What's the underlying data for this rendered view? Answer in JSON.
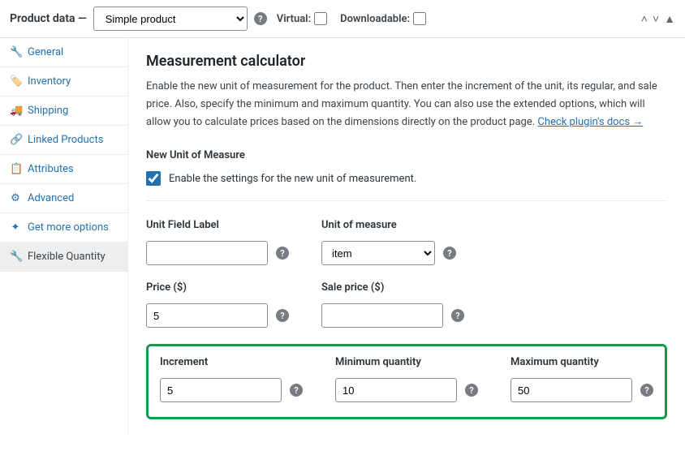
{
  "header": {
    "title": "Product data —",
    "product_type": "Simple product",
    "virtual_label": "Virtual:",
    "downloadable_label": "Downloadable:"
  },
  "sidebar": {
    "items": [
      {
        "label": "General",
        "icon": "🔧"
      },
      {
        "label": "Inventory",
        "icon": "🏷️"
      },
      {
        "label": "Shipping",
        "icon": "🚚"
      },
      {
        "label": "Linked Products",
        "icon": "🔗"
      },
      {
        "label": "Attributes",
        "icon": "📋"
      },
      {
        "label": "Advanced",
        "icon": "⚙"
      },
      {
        "label": "Get more options",
        "icon": "✦"
      },
      {
        "label": "Flexible Quantity",
        "icon": "🔧"
      }
    ]
  },
  "content": {
    "heading": "Measurement calculator",
    "description": "Enable the new unit of measurement for the product. Then enter the increment of the unit, its regular, and sale price. Also, specify the minimum and maximum quantity. You can also use the extended options, which will allow you to calculate prices based on the dimensions directly on the product page. ",
    "docs_link": "Check plugin's docs →",
    "new_unit_title": "New Unit of Measure",
    "enable_label": "Enable the settings for the new unit of measurement.",
    "fields": {
      "unit_field_label": {
        "label": "Unit Field Label",
        "value": ""
      },
      "unit_of_measure": {
        "label": "Unit of measure",
        "value": "item"
      },
      "price": {
        "label": "Price ($)",
        "value": "5"
      },
      "sale_price": {
        "label": "Sale price ($)",
        "value": ""
      },
      "increment": {
        "label": "Increment",
        "value": "5"
      },
      "min_qty": {
        "label": "Minimum quantity",
        "value": "10"
      },
      "max_qty": {
        "label": "Maximum quantity",
        "value": "50"
      }
    }
  }
}
